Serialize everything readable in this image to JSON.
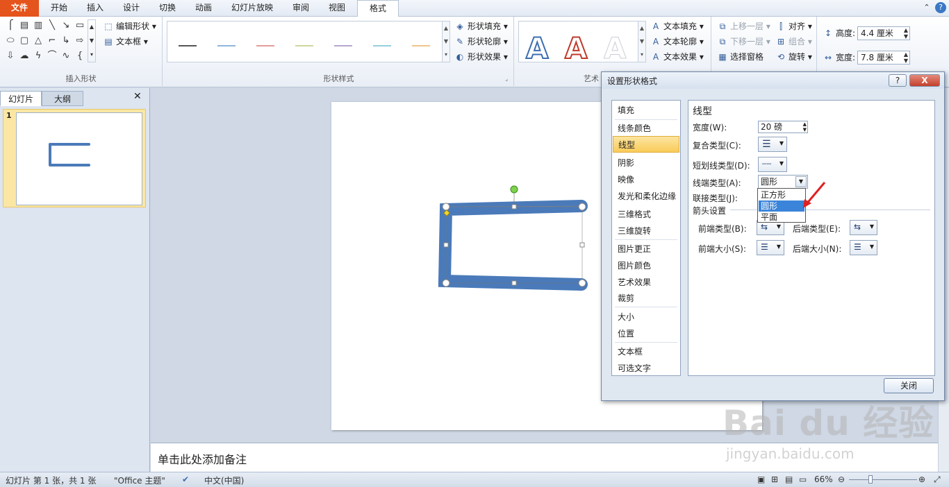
{
  "ribbon_tabs": [
    "文件",
    "开始",
    "插入",
    "设计",
    "切换",
    "动画",
    "幻灯片放映",
    "审阅",
    "视图",
    "格式"
  ],
  "ribbon": {
    "insert_shapes": {
      "label": "插入形状",
      "edit_shape": "编辑形状",
      "text_box": "文本框"
    },
    "shape_styles": {
      "label": "形状样式",
      "fill": "形状填充",
      "outline": "形状轮廓",
      "effects": "形状效果"
    },
    "wordart": {
      "label": "艺术",
      "letters": [
        "A",
        "A",
        "A"
      ],
      "text_fill": "文本填充",
      "text_outline": "文本轮廓",
      "text_effects": "文本效果"
    },
    "arrange": {
      "bring_forward": "上移一层",
      "send_backward": "下移一层",
      "selection_pane": "选择窗格",
      "align": "对齐",
      "group": "组合",
      "rotate": "旋转"
    },
    "size": {
      "height_label": "高度:",
      "height_value": "4.4 厘米",
      "width_label": "宽度:",
      "width_value": "7.8 厘米"
    }
  },
  "slides_pane": {
    "tab_slides": "幻灯片",
    "tab_outline": "大纲",
    "close": "✕",
    "slide_number": "1"
  },
  "notes_placeholder": "单击此处添加备注",
  "status": {
    "slide_info": "幻灯片 第 1 张，共 1 张",
    "theme": "\"Office 主题\"",
    "language": "中文(中国)",
    "zoom": "66%"
  },
  "dialog": {
    "title": "设置形状格式",
    "help": "?",
    "close_x": "X",
    "nav_items": [
      "填充",
      "线条颜色",
      "线型",
      "阴影",
      "映像",
      "发光和柔化边缘",
      "三维格式",
      "三维旋转",
      "图片更正",
      "图片颜色",
      "艺术效果",
      "裁剪",
      "大小",
      "位置",
      "文本框",
      "可选文字"
    ],
    "section_title": "线型",
    "width_label": "宽度(W):",
    "width_value": "20 磅",
    "compound_label": "复合类型(C):",
    "dash_label": "短划线类型(D):",
    "cap_label": "线端类型(A):",
    "cap_value": "圆形",
    "join_label": "联接类型(J):",
    "arrow_section": "箭头设置",
    "begin_type": "前端类型(B):",
    "end_type": "后端类型(E):",
    "begin_size": "前端大小(S):",
    "end_size": "后端大小(N):",
    "cap_options": [
      "正方形",
      "圆形",
      "平面"
    ],
    "close_button": "关闭"
  },
  "watermark": {
    "main": "Bai du 经验",
    "sub": "jingyan.baidu.com"
  }
}
